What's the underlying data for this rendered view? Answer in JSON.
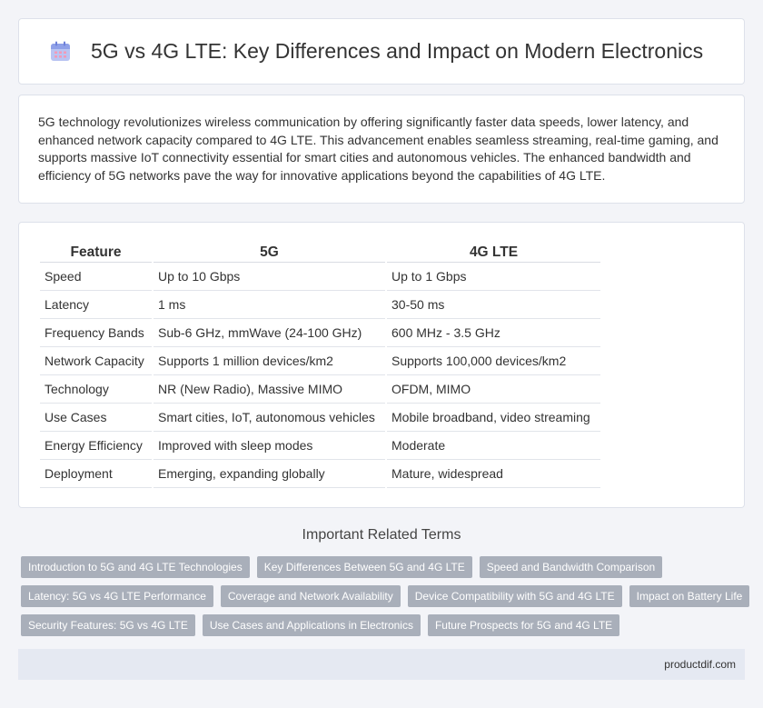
{
  "header": {
    "title": "5G vs 4G LTE: Key Differences and Impact on Modern Electronics",
    "icon": "calendar-icon",
    "icon_color": "#8fa0e8"
  },
  "intro": {
    "text": "5G technology revolutionizes wireless communication by offering significantly faster data speeds, lower latency, and enhanced network capacity compared to 4G LTE. This advancement enables seamless streaming, real-time gaming, and supports massive IoT connectivity essential for smart cities and autonomous vehicles. The enhanced bandwidth and efficiency of 5G networks pave the way for innovative applications beyond the capabilities of 4G LTE."
  },
  "table": {
    "headers": [
      "Feature",
      "5G",
      "4G LTE"
    ],
    "rows": [
      [
        "Speed",
        "Up to 10 Gbps",
        "Up to 1 Gbps"
      ],
      [
        "Latency",
        "1 ms",
        "30-50 ms"
      ],
      [
        "Frequency Bands",
        "Sub-6 GHz, mmWave (24-100 GHz)",
        "600 MHz - 3.5 GHz"
      ],
      [
        "Network Capacity",
        "Supports 1 million devices/km2",
        "Supports 100,000 devices/km2"
      ],
      [
        "Technology",
        "NR (New Radio), Massive MIMO",
        "OFDM, MIMO"
      ],
      [
        "Use Cases",
        "Smart cities, IoT, autonomous vehicles",
        "Mobile broadband, video streaming"
      ],
      [
        "Energy Efficiency",
        "Improved with sleep modes",
        "Moderate"
      ],
      [
        "Deployment",
        "Emerging, expanding globally",
        "Mature, widespread"
      ]
    ]
  },
  "related": {
    "title": "Important Related Terms",
    "rows": [
      [
        "Introduction to 5G and 4G LTE Technologies",
        "Key Differences Between 5G and 4G LTE",
        "Speed and Bandwidth Comparison"
      ],
      [
        "Latency: 5G vs 4G LTE Performance",
        "Coverage and Network Availability",
        "Device Compatibility with 5G and 4G LTE",
        "Impact on Battery Life"
      ],
      [
        "Security Features: 5G vs 4G LTE",
        "Use Cases and Applications in Electronics",
        "Future Prospects for 5G and 4G LTE"
      ]
    ],
    "tag_color": "#a9afba"
  },
  "footer": {
    "site": "productdif.com"
  }
}
